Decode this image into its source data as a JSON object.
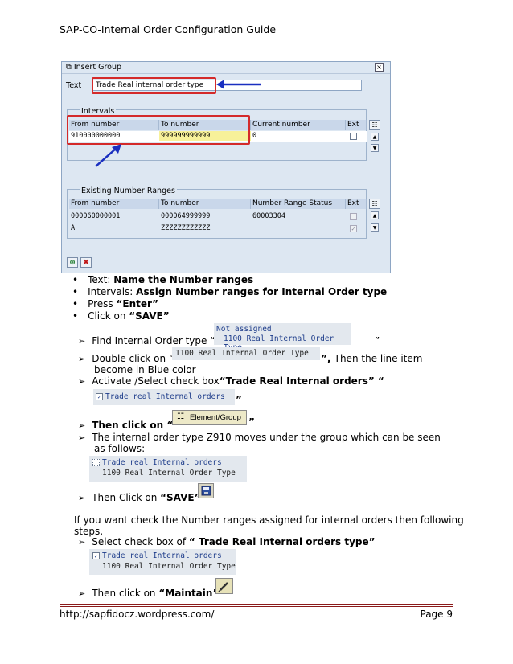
{
  "header": {
    "title": "SAP-CO-Internal Order Configuration Guide"
  },
  "dialog": {
    "title": "Insert Group",
    "text_label": "Text",
    "text_value": "Trade Real internal order type",
    "intervals": {
      "title": "Intervals",
      "columns": [
        "From number",
        "To number",
        "Current number",
        "Ext"
      ],
      "row": {
        "from": "910000000000",
        "to": "999999999999",
        "current": "0"
      }
    },
    "existing": {
      "title": "Existing Number Ranges",
      "columns": [
        "From number",
        "To number",
        "Number Range Status",
        "Ext"
      ],
      "rows": [
        {
          "from": "000060000001",
          "to": "000064999999",
          "status": "60003304",
          "ext_checked": false
        },
        {
          "from": "A",
          "to": "ZZZZZZZZZZZZ",
          "status": "",
          "ext_checked": true
        }
      ]
    }
  },
  "bullets": [
    {
      "prefix": "Text: ",
      "bold": "Name the Number ranges"
    },
    {
      "prefix": "Intervals: ",
      "bold": "Assign Number ranges for Internal Order type"
    },
    {
      "prefix": "Press ",
      "bold": "“Enter”"
    },
    {
      "prefix": "Click on ",
      "bold": "“SAVE”"
    }
  ],
  "steps": {
    "find": {
      "text": "Find Internal Order type “",
      "close": "”",
      "snip_line1": "Not assigned",
      "snip_line2": "1100 Real Internal Order Type"
    },
    "dbl": {
      "text": "Double click on “",
      "snip": "1100 Real Internal Order Type",
      "close_bold": "”, ",
      "after": "Then the line item",
      "line2": "become in Blue color"
    },
    "activate": {
      "text": "Activate /Select check box",
      "bold": "“Trade Real Internal orders” “",
      "snip": "Trade real Internal orders",
      "close": "”"
    },
    "then_click": {
      "bold": "Then click on “",
      "btn": "Element/Group",
      "close": "”"
    },
    "moves": {
      "line1": "The internal order type Z910 moves under the group which can be seen",
      "line2": "as follows:-",
      "snip_line1": "Trade real Internal orders",
      "snip_line2": "1100 Real Internal Order Type"
    },
    "save": {
      "text": "Then Click on ",
      "bold": "“SAVE”"
    },
    "para_line1": "If you want check the Number ranges assigned for internal orders then following",
    "para_line2": "steps,",
    "select": {
      "text": "Select check box of ",
      "bold": "“ Trade Real Internal orders type”",
      "snip_line1": "Trade real Internal orders",
      "snip_line2": "1100 Real Internal Order Type"
    },
    "maintain": {
      "text": "Then click on ",
      "bold": "“Maintain”"
    }
  },
  "footer": {
    "url": "http://sapfidocz.wordpress.com/",
    "page": "Page 9"
  },
  "symbols": {
    "bullet": "•",
    "arrow": "➢"
  }
}
